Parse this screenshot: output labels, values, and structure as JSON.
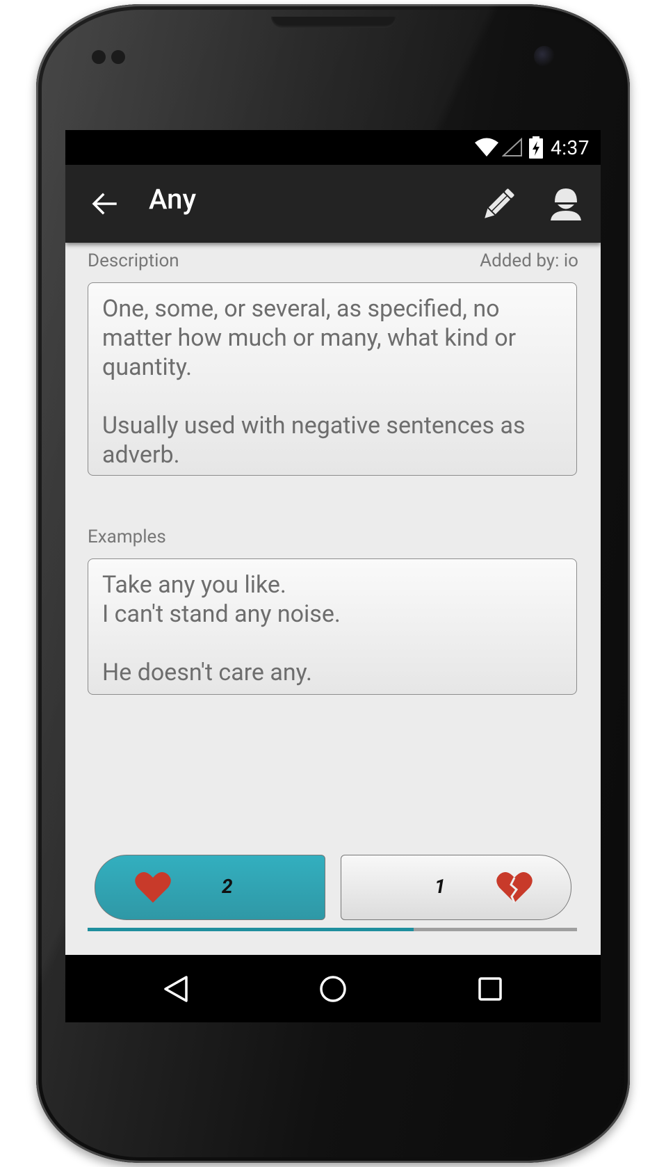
{
  "status_bar": {
    "time": "4:37",
    "icons": [
      "wifi-icon",
      "cell-signal-icon",
      "battery-charging-icon"
    ]
  },
  "app_bar": {
    "title": "Any",
    "nav_icon": "arrow-back-icon",
    "actions": [
      "pencil-edit-icon",
      "account-icon"
    ]
  },
  "description": {
    "label": "Description",
    "added_by": "Added by: io",
    "text": "One, some, or several, as specified, no matter how much or many, what kind or quantity.\n\nUsually used with negative sentences as adverb."
  },
  "examples": {
    "label": "Examples",
    "text": "Take any you like.\nI can't stand any noise.\n\nHe doesn't care any."
  },
  "votes": {
    "likes": "2",
    "dislikes": "1",
    "like_icon": "heart-icon",
    "dislike_icon": "broken-heart-icon",
    "like_color": "#2fa6b4",
    "heart_color": "#c83a2a",
    "like_ratio": 0.6667
  },
  "nav_bar": {
    "buttons": [
      "back-triangle-icon",
      "home-circle-icon",
      "recents-square-icon"
    ]
  }
}
